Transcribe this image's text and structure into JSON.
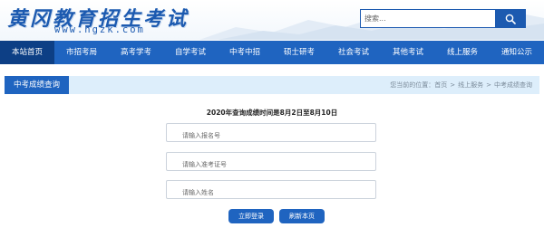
{
  "header": {
    "logo_text": "黄冈教育招生考试",
    "logo_url": "www.hgzk.com",
    "search_placeholder": "搜索..."
  },
  "nav": {
    "items": [
      {
        "label": "本站首页",
        "active": true
      },
      {
        "label": "市招考局",
        "active": false
      },
      {
        "label": "高考学考",
        "active": false
      },
      {
        "label": "自学考试",
        "active": false
      },
      {
        "label": "中考中招",
        "active": false
      },
      {
        "label": "硕士研考",
        "active": false
      },
      {
        "label": "社会考试",
        "active": false
      },
      {
        "label": "其他考试",
        "active": false
      },
      {
        "label": "线上服务",
        "active": false
      },
      {
        "label": "通知公示",
        "active": false
      }
    ]
  },
  "panel": {
    "title": "中考成绩查询",
    "breadcrumb": {
      "prefix": "您当前的位置：",
      "items": [
        "首页",
        "线上服务",
        "中考成绩查询"
      ],
      "separator": ">"
    }
  },
  "form": {
    "notice": "2020年查询成绩时间是8月2日至8月10日",
    "fields": [
      {
        "placeholder": "请输入报名号"
      },
      {
        "placeholder": "请输入准考证号"
      },
      {
        "placeholder": "请输入姓名"
      }
    ],
    "submit_label": "立即登录",
    "refresh_label": "刷新本页"
  },
  "colors": {
    "brand_blue": "#1f64c0",
    "nav_active": "#0d3f85",
    "panel_bg": "#ddeefb"
  },
  "icons": {
    "search_button": "search-icon"
  }
}
